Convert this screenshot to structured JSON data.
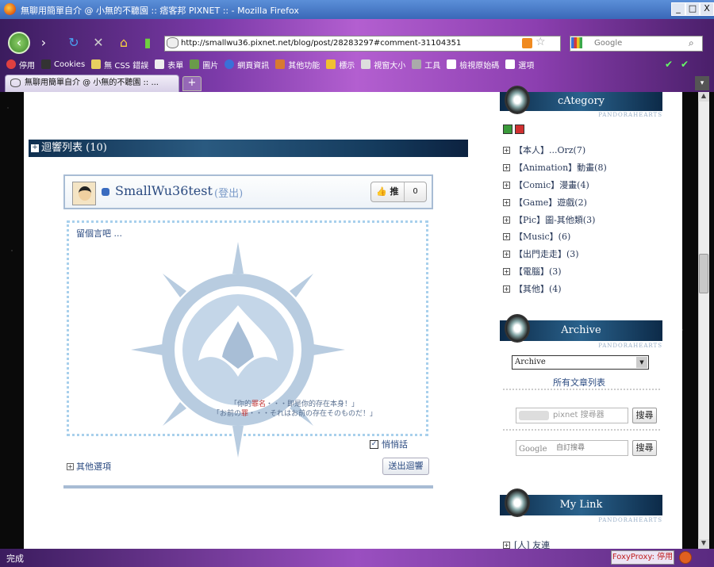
{
  "window": {
    "title": "無聊用簡單自介 @ 小無的不聽園 :: 痞客邦 PIXNET :: - Mozilla Firefox",
    "minimize": "_",
    "maximize": "□",
    "close": "X"
  },
  "navbar": {
    "url": "http://smallwu36.pixnet.net/blog/post/28283297#comment-31104351",
    "search_placeholder": "Google"
  },
  "bookmarks": [
    "停用",
    "Cookies",
    "無 CSS 錯誤",
    "表單",
    "圖片",
    "網頁資訊",
    "其他功能",
    "標示",
    "視窗大小",
    "工具",
    "檢視原始碼",
    "選項"
  ],
  "tab": {
    "label": "無聊用簡單自介 @ 小無的不聽園 :: ...",
    "new_tab": "+",
    "list": "▾"
  },
  "comments": {
    "header": "迴響列表 (10)",
    "user": "SmallWu36test",
    "logout": "(登出)",
    "push_label": "推",
    "push_count": "0",
    "placeholder": "留個言吧 ...",
    "quote1_pre": "「你的",
    "quote1_red": "罪名",
    "quote1_post": "・・・即是你的存在本身！」",
    "quote2_pre": "「お前の",
    "quote2_red": "罪",
    "quote2_post": "・・・それはお前の存在そのものだ！」",
    "secret_label": "悄悄話",
    "secret_check": "✓",
    "other_options": "其他選項",
    "send_button": "送出迴響"
  },
  "sidebar": {
    "category_title": "cAtegory",
    "subtitle": "PANDORAHEARTS",
    "categories": [
      "【本人】...Orz(7)",
      "【Animation】動畫(8)",
      "【Comic】漫畫(4)",
      "【Game】遊戲(2)",
      "【Pic】圖-其他類(3)",
      "【Music】(6)",
      "【出門走走】(3)",
      "【電腦】(3)",
      "【其他】(4)"
    ],
    "archive_title": "Archive",
    "archive_selected": "Archive",
    "all_posts": "所有文章列表",
    "pixnet_search_placeholder": "pixnet 搜尋器",
    "search_button": "搜尋",
    "google_logo": "Google",
    "google_search_placeholder": "自訂搜尋",
    "mylink_title": "My Link",
    "link1": "[人] 友連"
  },
  "status": {
    "text": "完成",
    "foxyproxy": "FoxyProxy: 停用"
  }
}
